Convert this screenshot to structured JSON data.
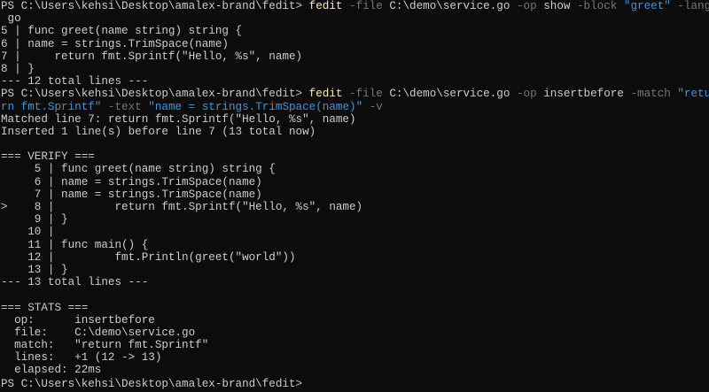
{
  "terminal": {
    "lines": [
      [
        {
          "t": "PS C:\\Users\\kehsi\\Desktop\\amalex-brand\\fedit> "
        },
        {
          "t": "fedit",
          "c": "cmd"
        },
        {
          "t": " -file",
          "c": "flag"
        },
        {
          "t": " C:\\demo\\service.go"
        },
        {
          "t": " -op",
          "c": "flag"
        },
        {
          "t": " show"
        },
        {
          "t": " -block",
          "c": "flag"
        },
        {
          "t": " \"greet\"",
          "c": "str"
        },
        {
          "t": " -lang",
          "c": "flag"
        }
      ],
      [
        {
          "t": " go"
        }
      ],
      [
        {
          "t": "5 | func greet(name string) string {"
        }
      ],
      [
        {
          "t": "6 | name = strings.TrimSpace(name)"
        }
      ],
      [
        {
          "t": "7 |     return fmt.Sprintf(\"Hello, %s\", name)"
        }
      ],
      [
        {
          "t": "8 | }"
        }
      ],
      [
        {
          "t": "--- 12 total lines ---"
        }
      ],
      [
        {
          "t": "PS C:\\Users\\kehsi\\Desktop\\amalex-brand\\fedit> "
        },
        {
          "t": "fedit",
          "c": "cmd"
        },
        {
          "t": " -file",
          "c": "flag"
        },
        {
          "t": " C:\\demo\\service.go"
        },
        {
          "t": " -op",
          "c": "flag"
        },
        {
          "t": " insertbefore"
        },
        {
          "t": " -match",
          "c": "flag"
        },
        {
          "t": " \"retu",
          "c": "str"
        }
      ],
      [
        {
          "t": "rn fmt.Sprintf\"",
          "c": "str"
        },
        {
          "t": " -text",
          "c": "flag"
        },
        {
          "t": " \"name = strings.TrimSpace(name)\"",
          "c": "str"
        },
        {
          "t": " -v",
          "c": "flag"
        }
      ],
      [
        {
          "t": "Matched line 7: return fmt.Sprintf(\"Hello, %s\", name)"
        }
      ],
      [
        {
          "t": "Inserted 1 line(s) before line 7 (13 total now)"
        }
      ],
      [
        {
          "t": ""
        }
      ],
      [
        {
          "t": "=== VERIFY ==="
        }
      ],
      [
        {
          "t": "     5 | func greet(name string) string {"
        }
      ],
      [
        {
          "t": "     6 | name = strings.TrimSpace(name)"
        }
      ],
      [
        {
          "t": "     7 | name = strings.TrimSpace(name)"
        }
      ],
      [
        {
          "t": ">    8 |         return fmt.Sprintf(\"Hello, %s\", name)"
        }
      ],
      [
        {
          "t": "     9 | }"
        }
      ],
      [
        {
          "t": "    10 |"
        }
      ],
      [
        {
          "t": "    11 | func main() {"
        }
      ],
      [
        {
          "t": "    12 |         fmt.Println(greet(\"world\"))"
        }
      ],
      [
        {
          "t": "    13 | }"
        }
      ],
      [
        {
          "t": "--- 13 total lines ---"
        }
      ],
      [
        {
          "t": ""
        }
      ],
      [
        {
          "t": "=== STATS ==="
        }
      ],
      [
        {
          "t": "  op:      insertbefore"
        }
      ],
      [
        {
          "t": "  file:    C:\\demo\\service.go"
        }
      ],
      [
        {
          "t": "  match:   \"return fmt.Sprintf\""
        }
      ],
      [
        {
          "t": "  lines:   +1 (12 -> 13)"
        }
      ],
      [
        {
          "t": "  elapsed: 22ms"
        }
      ],
      [
        {
          "t": "PS C:\\Users\\kehsi\\Desktop\\amalex-brand\\fedit> "
        }
      ]
    ]
  },
  "colors": {
    "background": "#0c0c0c",
    "foreground": "#cccccc",
    "command": "#f9f1a5",
    "parameter": "#767676",
    "string": "#3a96dd"
  }
}
